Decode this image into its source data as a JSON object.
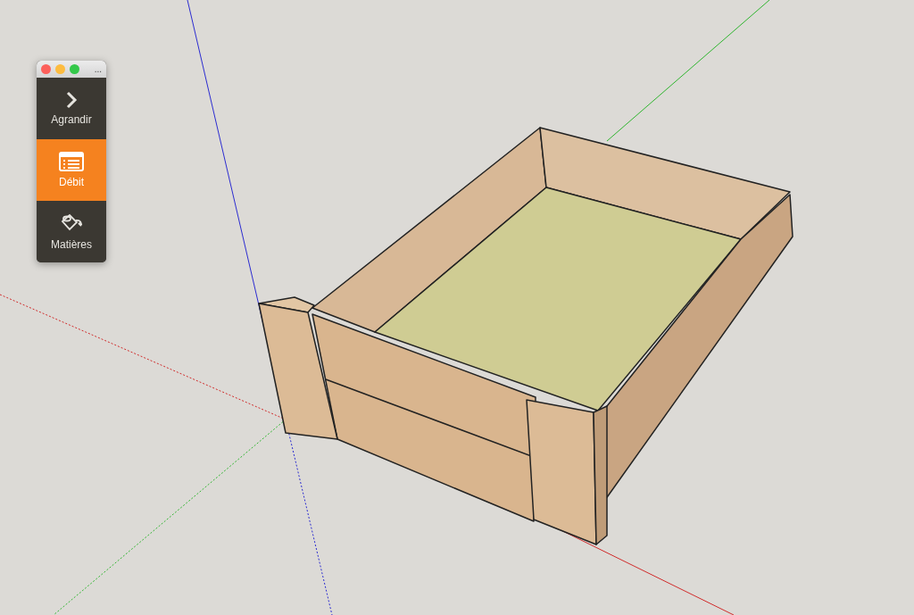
{
  "panel": {
    "title_menu": "...",
    "items": [
      {
        "kind": "expand",
        "label": "Agrandir",
        "selected": false
      },
      {
        "kind": "list",
        "label": "Débit",
        "selected": true
      },
      {
        "kind": "paint",
        "label": "Matières",
        "selected": false
      }
    ]
  }
}
